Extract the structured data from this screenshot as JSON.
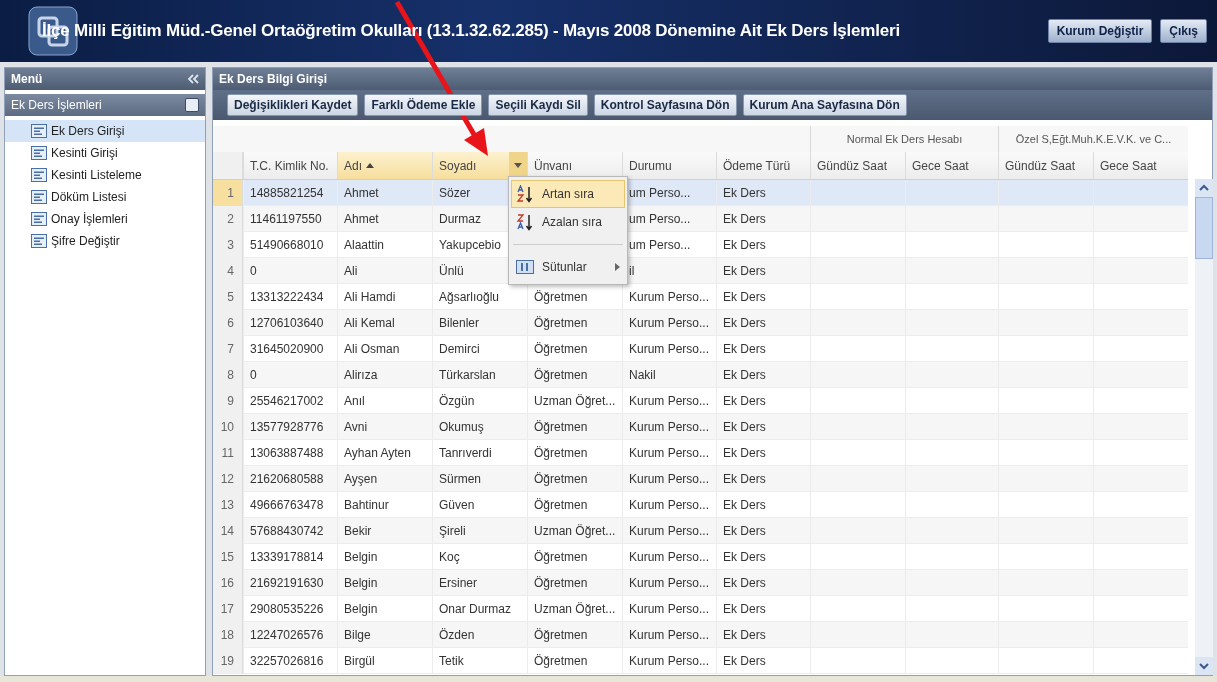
{
  "window": {
    "title": "İlçe Milli Eğitim Müd.-Genel Ortaöğretim Okulları (13.1.32.62.285) - Mayıs 2008 Dönemine Ait Ek Ders İşlemleri",
    "buttons": [
      "Kurum Değiştir",
      "Çıkış"
    ]
  },
  "sidebar": {
    "title": "Menü",
    "section": "Ek Ders İşlemleri",
    "items": [
      {
        "label": "Ek Ders Girişi",
        "selected": true
      },
      {
        "label": "Kesinti Girişi",
        "selected": false
      },
      {
        "label": "Kesinti Listeleme",
        "selected": false
      },
      {
        "label": "Döküm Listesi",
        "selected": false
      },
      {
        "label": "Onay İşlemleri",
        "selected": false
      },
      {
        "label": "Şifre Değiştir",
        "selected": false
      }
    ]
  },
  "panel": {
    "title": "Ek Ders Bilgi Girişi",
    "toolbar": [
      "Değişiklikleri Kaydet",
      "Farklı Ödeme Ekle",
      "Seçili Kaydı Sil",
      "Kontrol Sayfasına Dön",
      "Kurum Ana Sayfasına Dön"
    ]
  },
  "table": {
    "groups": [
      "Normal Ek Ders Hesabı",
      "Özel S,Eğt.Muh.K.E.V.K. ve C..."
    ],
    "columns": [
      {
        "label": "T.C. Kimlik No.",
        "sorted_ascending": false,
        "menu_open": false
      },
      {
        "label": "Adı",
        "sorted_ascending": true,
        "menu_open": false
      },
      {
        "label": "Soyadı",
        "sorted_ascending": false,
        "menu_open": true
      },
      {
        "label": "Ünvanı",
        "sorted_ascending": false,
        "menu_open": false
      },
      {
        "label": "Durumu",
        "sorted_ascending": false,
        "menu_open": false
      },
      {
        "label": "Ödeme Türü",
        "sorted_ascending": false,
        "menu_open": false
      },
      {
        "label": "Gündüz Saat",
        "sorted_ascending": false,
        "menu_open": false
      },
      {
        "label": "Gece Saat",
        "sorted_ascending": false,
        "menu_open": false
      },
      {
        "label": "Gündüz Saat",
        "sorted_ascending": false,
        "menu_open": false
      },
      {
        "label": "Gece Saat",
        "sorted_ascending": false,
        "menu_open": false
      }
    ],
    "rows": [
      {
        "n": "1",
        "cells": [
          "14885821254",
          "Ahmet",
          "Sözer",
          null,
          "um Perso...",
          "Ek Ders"
        ],
        "selected": true
      },
      {
        "n": "2",
        "cells": [
          "11461197550",
          "Ahmet",
          "Durmaz",
          null,
          "um Perso...",
          "Ek Ders"
        ],
        "selected": false
      },
      {
        "n": "3",
        "cells": [
          "51490668010",
          "Alaattin",
          "Yakupcebio",
          null,
          "um Perso...",
          "Ek Ders"
        ],
        "selected": false
      },
      {
        "n": "4",
        "cells": [
          "0",
          "Ali",
          "Ünlü",
          null,
          "il",
          "Ek Ders"
        ],
        "selected": false
      },
      {
        "n": "5",
        "cells": [
          "13313222434",
          "Ali Hamdi",
          "Ağsarlıoğlu",
          "Öğretmen",
          "Kurum Perso...",
          "Ek Ders"
        ],
        "selected": false
      },
      {
        "n": "6",
        "cells": [
          "12706103640",
          "Ali Kemal",
          "Bilenler",
          "Öğretmen",
          "Kurum Perso...",
          "Ek Ders"
        ],
        "selected": false
      },
      {
        "n": "7",
        "cells": [
          "31645020900",
          "Ali Osman",
          "Demirci",
          "Öğretmen",
          "Kurum Perso...",
          "Ek Ders"
        ],
        "selected": false
      },
      {
        "n": "8",
        "cells": [
          "0",
          "Alirıza",
          "Türkarslan",
          "Öğretmen",
          "Nakil",
          "Ek Ders"
        ],
        "selected": false
      },
      {
        "n": "9",
        "cells": [
          "25546217002",
          "Anıl",
          "Özgün",
          "Uzman Öğret...",
          "Kurum Perso...",
          "Ek Ders"
        ],
        "selected": false
      },
      {
        "n": "10",
        "cells": [
          "13577928776",
          "Avni",
          "Okumuş",
          "Öğretmen",
          "Kurum Perso...",
          "Ek Ders"
        ],
        "selected": false
      },
      {
        "n": "11",
        "cells": [
          "13063887488",
          "Ayhan Ayten",
          "Tanrıverdi",
          "Öğretmen",
          "Kurum Perso...",
          "Ek Ders"
        ],
        "selected": false
      },
      {
        "n": "12",
        "cells": [
          "21620680588",
          "Ayşen",
          "Sürmen",
          "Öğretmen",
          "Kurum Perso...",
          "Ek Ders"
        ],
        "selected": false
      },
      {
        "n": "13",
        "cells": [
          "49666763478",
          "Bahtinur",
          "Güven",
          "Öğretmen",
          "Kurum Perso...",
          "Ek Ders"
        ],
        "selected": false
      },
      {
        "n": "14",
        "cells": [
          "57688430742",
          "Bekir",
          "Şireli",
          "Uzman Öğret...",
          "Kurum Perso...",
          "Ek Ders"
        ],
        "selected": false
      },
      {
        "n": "15",
        "cells": [
          "13339178814",
          "Belgin",
          "Koç",
          "Öğretmen",
          "Kurum Perso...",
          "Ek Ders"
        ],
        "selected": false
      },
      {
        "n": "16",
        "cells": [
          "21692191630",
          "Belgin",
          "Ersiner",
          "Öğretmen",
          "Kurum Perso...",
          "Ek Ders"
        ],
        "selected": false
      },
      {
        "n": "17",
        "cells": [
          "29080535226",
          "Belgin",
          "Onar Durmaz",
          "Uzman Öğret...",
          "Kurum Perso...",
          "Ek Ders"
        ],
        "selected": false
      },
      {
        "n": "18",
        "cells": [
          "12247026576",
          "Bilge",
          "Özden",
          "Öğretmen",
          "Kurum Perso...",
          "Ek Ders"
        ],
        "selected": false
      },
      {
        "n": "19",
        "cells": [
          "32257026816",
          "Birgül",
          "Tetik",
          "Öğretmen",
          "Kurum Perso...",
          "Ek Ders"
        ],
        "selected": false
      }
    ]
  },
  "column_menu": {
    "items": [
      {
        "kind": "sort-asc",
        "label": "Artan sıra",
        "selected": true
      },
      {
        "kind": "sort-desc",
        "label": "Azalan sıra",
        "selected": false
      },
      {
        "kind": "columns",
        "label": "Sütunlar",
        "selected": false
      }
    ]
  }
}
